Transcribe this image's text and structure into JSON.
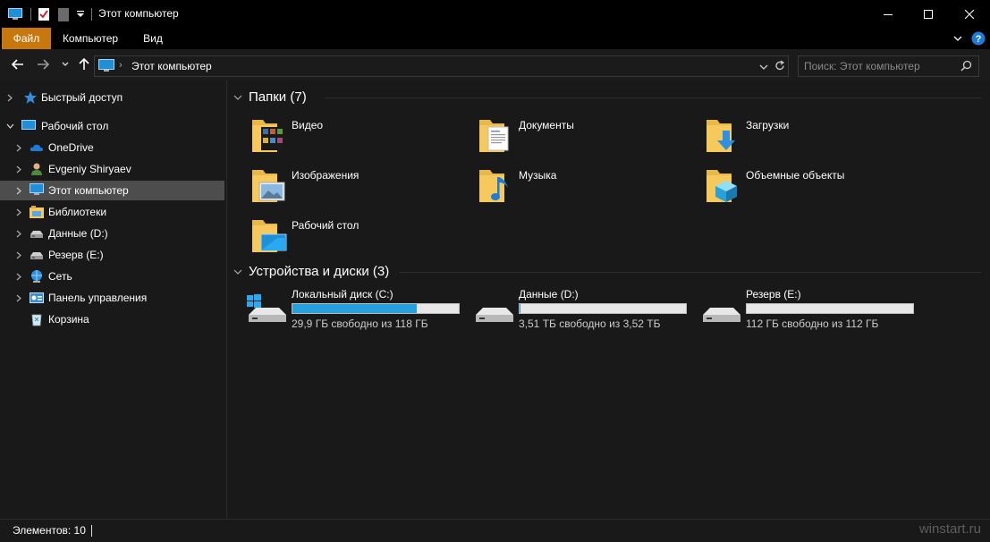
{
  "window": {
    "title": "Этот компьютер",
    "controls": {
      "minimize": "minimize",
      "maximize": "maximize",
      "close": "close"
    }
  },
  "ribbon": {
    "tabs": [
      {
        "label": "Файл",
        "active": true
      },
      {
        "label": "Компьютер",
        "active": false
      },
      {
        "label": "Вид",
        "active": false
      }
    ]
  },
  "navbar": {
    "address": {
      "path": "Этот компьютер"
    },
    "search": {
      "placeholder": "Поиск: Этот компьютер"
    }
  },
  "navpane": {
    "items": [
      {
        "label": "Быстрый доступ",
        "icon": "star-icon",
        "level": 0,
        "expanded": false
      },
      {
        "label": "Рабочий стол",
        "icon": "desktop-icon",
        "level": 0,
        "expanded": true
      },
      {
        "label": "OneDrive",
        "icon": "onedrive-icon",
        "level": 1,
        "expanded": false
      },
      {
        "label": "Evgeniy Shiryaev",
        "icon": "user-icon",
        "level": 1,
        "expanded": false
      },
      {
        "label": "Этот компьютер",
        "icon": "computer-icon",
        "level": 1,
        "expanded": false,
        "selected": true
      },
      {
        "label": "Библиотеки",
        "icon": "libraries-icon",
        "level": 1,
        "expanded": false
      },
      {
        "label": "Данные (D:)",
        "icon": "drive-icon",
        "level": 1,
        "expanded": false
      },
      {
        "label": "Резерв (E:)",
        "icon": "drive-icon",
        "level": 1,
        "expanded": false
      },
      {
        "label": "Сеть",
        "icon": "network-icon",
        "level": 1,
        "expanded": false
      },
      {
        "label": "Панель управления",
        "icon": "control-panel-icon",
        "level": 1,
        "expanded": false
      },
      {
        "label": "Корзина",
        "icon": "recycle-bin-icon",
        "level": 1,
        "expanded": false
      }
    ]
  },
  "content": {
    "folders_header": "Папки (7)",
    "folders": [
      {
        "label": "Видео",
        "icon": "video-folder-icon"
      },
      {
        "label": "Документы",
        "icon": "documents-folder-icon"
      },
      {
        "label": "Загрузки",
        "icon": "downloads-folder-icon"
      },
      {
        "label": "Изображения",
        "icon": "pictures-folder-icon"
      },
      {
        "label": "Музыка",
        "icon": "music-folder-icon"
      },
      {
        "label": "Объемные объекты",
        "icon": "3d-objects-folder-icon"
      },
      {
        "label": "Рабочий стол",
        "icon": "desktop-folder-icon"
      }
    ],
    "drives_header": "Устройства и диски (3)",
    "drives": [
      {
        "label": "Локальный диск (C:)",
        "free_text": "29,9 ГБ свободно из 118 ГБ",
        "used_fraction": 0.747,
        "system": true
      },
      {
        "label": "Данные (D:)",
        "free_text": "3,51 ТБ свободно из 3,52 ТБ",
        "used_fraction": 0.003,
        "system": false
      },
      {
        "label": "Резерв (E:)",
        "free_text": "112 ГБ свободно из 112 ГБ",
        "used_fraction": 0.0,
        "system": false
      }
    ]
  },
  "status": {
    "items_count": "Элементов: 10",
    "watermark": "winstart.ru"
  },
  "colors": {
    "accent_tab": "#c8770f",
    "drive_bar_fill": "#26a0da",
    "selected_row": "#4d4d4d",
    "folder_yellow": "#f5c95c"
  }
}
